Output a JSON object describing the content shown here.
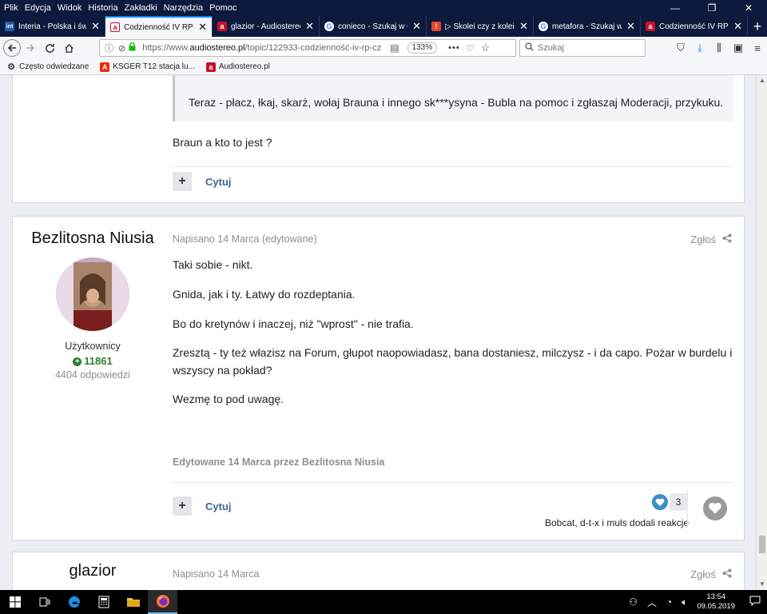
{
  "menu": [
    "Plik",
    "Edycja",
    "Widok",
    "Historia",
    "Zakładki",
    "Narzędzia",
    "Pomoc"
  ],
  "window_controls": [
    "—",
    "❐",
    "✕"
  ],
  "tabs": [
    {
      "label": "Interia - Polska i świat",
      "icon": "interia-icon",
      "color": "#1e5aa8",
      "glyph": "int",
      "active": false
    },
    {
      "label": "Codzienność IV RP czy",
      "icon": "audiostereo-icon",
      "color": "#c8102e",
      "glyph": "a",
      "active": true
    },
    {
      "label": "glazior - Audiostereo.pl",
      "icon": "audiostereo-icon",
      "color": "#c8102e",
      "glyph": "a",
      "active": false
    },
    {
      "label": "conieco - Szukaj w Go",
      "icon": "google-icon",
      "color": "#ffffff",
      "glyph": "G",
      "active": false
    },
    {
      "label": "▷ Skolei czy z kolei? -",
      "icon": "site-icon",
      "color": "#e8442c",
      "glyph": "!",
      "active": false
    },
    {
      "label": "metafora - Szukaj w Go",
      "icon": "google-icon",
      "color": "#ffffff",
      "glyph": "G",
      "active": false
    },
    {
      "label": "Codzienność IV RP czy",
      "icon": "audiostereo-icon",
      "color": "#c8102e",
      "glyph": "a",
      "active": false
    }
  ],
  "nav": {
    "url_prefix": "https://www.",
    "url_domain": "audiostereo.pl",
    "url_path": "/topic/122933-codzienność-iv-rp-cz",
    "zoom": "133%",
    "search_placeholder": "Szukaj"
  },
  "bookmarks": [
    {
      "label": "Często odwiedzane",
      "icon": "gear-icon",
      "color": "#444444",
      "glyph": "⚙"
    },
    {
      "label": "KSGER T12 stacja lu...",
      "icon": "aliexpress-icon",
      "color": "#e62e04",
      "glyph": "A"
    },
    {
      "label": "Audiostereo.pl",
      "icon": "audiostereo-icon",
      "color": "#c8102e",
      "glyph": "a"
    }
  ],
  "post1": {
    "quote": "Teraz - płacz, łkaj, skarż, wołaj Brauna i innego sk***ysyna - Bubla na pomoc i zgłaszaj Moderacji, przykuku.",
    "text": "Braun a kto to jest ?",
    "quote_label": "Cytuj",
    "plus": "+"
  },
  "post2": {
    "author": "Bezlitosna Niusia",
    "role": "Użytkownicy",
    "reputation": "11861",
    "answers": "4404 odpowiedzi",
    "meta": "Napisano 14 Marca (edytowane)",
    "report": "Zgłoś",
    "paragraphs": [
      "Taki sobie - nikt.",
      "Gnida, jak i ty. Łatwy do rozdeptania.",
      "Bo do kretynów i inaczej, niż \"wprost\" - nie trafia.",
      "Zresztą - ty też włazisz na Forum, głupot naopowiadasz, bana dostaniesz, milczysz - i da capo. Pożar w burdelu i",
      "wszyscy na pokład?",
      "Wezmę to pod uwagę."
    ],
    "edited": "Edytowane 14 Marca przez Bezlitosna Niusia",
    "quote_label": "Cytuj",
    "plus": "+",
    "reaction_count": "3",
    "reactors": "Bobcat, d-t-x i muls dodali reakcje"
  },
  "post3": {
    "author": "glazior",
    "meta": "Napisano 14 Marca",
    "report": "Zgłoś"
  },
  "tray": {
    "time": "13:54",
    "date": "09.05.2019"
  }
}
